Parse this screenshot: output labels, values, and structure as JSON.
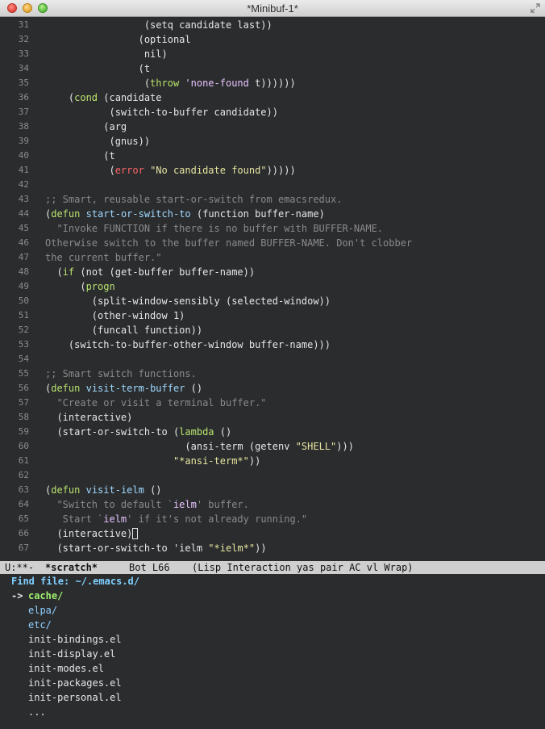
{
  "window": {
    "title": "*Minibuf-1*"
  },
  "code_lines": [
    {
      "n": "31",
      "parts": [
        [
          "",
          "                 (setq candidate last))"
        ]
      ]
    },
    {
      "n": "32",
      "parts": [
        [
          "",
          "                (optional"
        ]
      ]
    },
    {
      "n": "33",
      "parts": [
        [
          "",
          "                 nil)"
        ]
      ]
    },
    {
      "n": "34",
      "parts": [
        [
          "",
          "                (t"
        ]
      ]
    },
    {
      "n": "35",
      "parts": [
        [
          "",
          "                 ("
        ],
        [
          "kw",
          "throw"
        ],
        [
          "",
          " "
        ],
        [
          "sym",
          "'none-found"
        ],
        [
          "",
          " t))))))"
        ]
      ]
    },
    {
      "n": "36",
      "parts": [
        [
          "",
          "    ("
        ],
        [
          "kw",
          "cond"
        ],
        [
          "",
          " (candidate"
        ]
      ]
    },
    {
      "n": "37",
      "parts": [
        [
          "",
          "           (switch-to-buffer candidate))"
        ]
      ]
    },
    {
      "n": "38",
      "parts": [
        [
          "",
          "          (arg"
        ]
      ]
    },
    {
      "n": "39",
      "parts": [
        [
          "",
          "           (gnus))"
        ]
      ]
    },
    {
      "n": "40",
      "parts": [
        [
          "",
          "          (t"
        ]
      ]
    },
    {
      "n": "41",
      "parts": [
        [
          "",
          "           ("
        ],
        [
          "err",
          "error"
        ],
        [
          "",
          " "
        ],
        [
          "str",
          "\"No candidate found\""
        ],
        [
          "",
          ")))))"
        ]
      ]
    },
    {
      "n": "42",
      "parts": []
    },
    {
      "n": "43",
      "parts": [
        [
          "comment",
          ";; Smart, reusable start-or-switch from emacsredux."
        ]
      ]
    },
    {
      "n": "44",
      "parts": [
        [
          "",
          "("
        ],
        [
          "kw",
          "defun"
        ],
        [
          "",
          " "
        ],
        [
          "fn",
          "start-or-switch-to"
        ],
        [
          "",
          " (function buffer-name)"
        ]
      ]
    },
    {
      "n": "45",
      "parts": [
        [
          "comment",
          "  \"Invoke FUNCTION if there is no buffer with BUFFER-NAME."
        ]
      ]
    },
    {
      "n": "46",
      "parts": [
        [
          "comment",
          "Otherwise switch to the buffer named BUFFER-NAME. Don't clobber"
        ]
      ]
    },
    {
      "n": "47",
      "parts": [
        [
          "comment",
          "the current buffer.\""
        ]
      ]
    },
    {
      "n": "48",
      "parts": [
        [
          "",
          "  ("
        ],
        [
          "kw",
          "if"
        ],
        [
          "",
          " (not (get-buffer buffer-name))"
        ]
      ]
    },
    {
      "n": "49",
      "parts": [
        [
          "",
          "      ("
        ],
        [
          "kw",
          "progn"
        ]
      ]
    },
    {
      "n": "50",
      "parts": [
        [
          "",
          "        (split-window-sensibly (selected-window))"
        ]
      ]
    },
    {
      "n": "51",
      "parts": [
        [
          "",
          "        (other-window 1)"
        ]
      ]
    },
    {
      "n": "52",
      "parts": [
        [
          "",
          "        (funcall function))"
        ]
      ]
    },
    {
      "n": "53",
      "parts": [
        [
          "",
          "    (switch-to-buffer-other-window buffer-name)))"
        ]
      ]
    },
    {
      "n": "54",
      "parts": []
    },
    {
      "n": "55",
      "parts": [
        [
          "comment",
          ";; Smart switch functions."
        ]
      ]
    },
    {
      "n": "56",
      "parts": [
        [
          "",
          "("
        ],
        [
          "kw",
          "defun"
        ],
        [
          "",
          " "
        ],
        [
          "fn",
          "visit-term-buffer"
        ],
        [
          "",
          " ()"
        ]
      ]
    },
    {
      "n": "57",
      "parts": [
        [
          "comment",
          "  \"Create or visit a terminal buffer.\""
        ]
      ]
    },
    {
      "n": "58",
      "parts": [
        [
          "",
          "  (interactive)"
        ]
      ]
    },
    {
      "n": "59",
      "parts": [
        [
          "",
          "  (start-or-switch-to ("
        ],
        [
          "kw",
          "lambda"
        ],
        [
          "",
          " ()"
        ]
      ]
    },
    {
      "n": "60",
      "parts": [
        [
          "",
          "                        (ansi-term (getenv "
        ],
        [
          "str",
          "\"SHELL\""
        ],
        [
          "",
          ")))"
        ]
      ]
    },
    {
      "n": "61",
      "parts": [
        [
          "",
          "                      "
        ],
        [
          "str",
          "\"*ansi-term*\""
        ],
        [
          "",
          "))"
        ]
      ]
    },
    {
      "n": "62",
      "parts": []
    },
    {
      "n": "63",
      "parts": [
        [
          "",
          "("
        ],
        [
          "kw",
          "defun"
        ],
        [
          "",
          " "
        ],
        [
          "fn",
          "visit-ielm"
        ],
        [
          "",
          " ()"
        ]
      ]
    },
    {
      "n": "64",
      "parts": [
        [
          "comment",
          "  \"Switch to default `"
        ],
        [
          "sym",
          "ielm"
        ],
        [
          "comment",
          "' buffer."
        ]
      ]
    },
    {
      "n": "65",
      "parts": [
        [
          "comment",
          "   Start `"
        ],
        [
          "sym",
          "ielm"
        ],
        [
          "comment",
          "' if it's not already running.\""
        ]
      ]
    },
    {
      "n": "66",
      "parts": [
        [
          "",
          "  (interactive)"
        ],
        [
          "cursor",
          ""
        ]
      ]
    },
    {
      "n": "67",
      "parts": [
        [
          "",
          "  (start-or-switch-to 'ielm "
        ],
        [
          "str",
          "\"*ielm*\""
        ],
        [
          "",
          "))"
        ]
      ]
    }
  ],
  "modeline": {
    "status": "U:**-",
    "buffer": "*scratch*",
    "position": "Bot L66",
    "modes": "(Lisp Interaction yas pair AC vl Wrap)"
  },
  "minibuffer": {
    "prompt": "Find file: ~/.emacs.d/",
    "arrow": "->",
    "items": [
      "cache/",
      "elpa/",
      "etc/",
      "init-bindings.el",
      "init-display.el",
      "init-modes.el",
      "init-packages.el",
      "init-personal.el",
      "..."
    ]
  },
  "colors": {
    "background": "#2b2c2e",
    "keyword": "#b9e36e",
    "function": "#9fd9ff",
    "string": "#e6e6a0",
    "comment": "#8a8a8a",
    "error": "#ff6565"
  }
}
